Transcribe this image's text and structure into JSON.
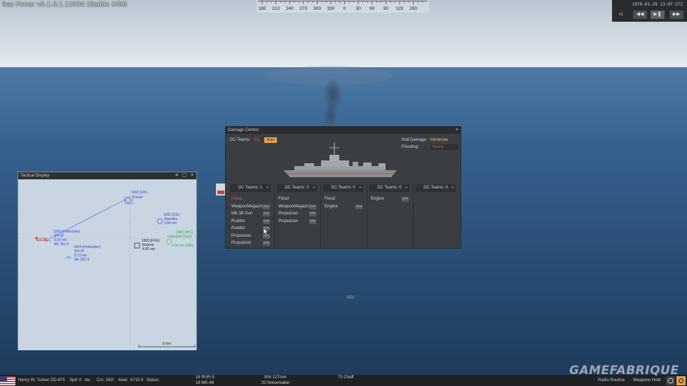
{
  "app": {
    "title": "Sea Power v0.1.0.1.12934 (Stable #60)"
  },
  "compass": {
    "ticks": [
      "180",
      "210",
      "240",
      "270",
      "300",
      "330",
      "0",
      "30",
      "60",
      "90",
      "120",
      "150"
    ]
  },
  "time_panel": {
    "datetime": "1979-01-29 13:07:37Z",
    "speed": "x1",
    "rewind_icon": "double-left-arrow",
    "play_pause_icon": "play-pause",
    "fast_forward_icon": "double-right-arrow"
  },
  "tactical": {
    "title": "Tactical Display",
    "scale": "5 km",
    "contacts": [
      {
        "id": "1002 (DD)",
        "name": "Tucker"
      },
      {
        "id": "1001 (CG)",
        "name": "Standley",
        "range": "3.84 nm"
      },
      {
        "id": "1005 (Helicopter)",
        "name": "SH-2F",
        "range": "9.02 nm",
        "alt": "Alt: 201 ft"
      },
      {
        "id": "1004 (Helicopter)",
        "name": "SH-2F",
        "range": "8.13 nm",
        "alt": "Alt: 201 ft"
      },
      {
        "id": "1003 (FFG)",
        "name": "Elsieon",
        "range": "4.82 nm"
      },
      {
        "id": "1002 (MG)",
        "name": "Unknown (Sub)",
        "range": "4.02 nm (ISR)"
      },
      {
        "time_marker": "13:38"
      }
    ]
  },
  "damage": {
    "title": "Damage Control",
    "dc_teams_label": "DC Teams:",
    "dc_teams_value": "0/1",
    "auto_label": "Auto",
    "hull_label": "Hull Damage:",
    "hull_value": "Moderate",
    "flooding_label": "Flooding:",
    "flooding_value": "Heavy",
    "go_label": ">>>",
    "columns": [
      {
        "head": "DC Teams: 1",
        "items": [
          {
            "label": "Flood",
            "flood": true,
            "go": false
          },
          {
            "label": "WeaponMagazine",
            "go": true
          },
          {
            "label": "MK 38 Gun",
            "go": true
          },
          {
            "label": "Rudder",
            "go": true
          },
          {
            "label": "Rudder",
            "go": true
          },
          {
            "label": "Propulsion",
            "go": true
          },
          {
            "label": "Propulsion",
            "go": true
          }
        ]
      },
      {
        "head": "DC Teams: 0",
        "items": [
          {
            "label": "Flood",
            "go": false
          },
          {
            "label": "WeaponMagazine",
            "go": true
          },
          {
            "label": "Propulsion",
            "go": true
          },
          {
            "label": "Propulsion",
            "go": true
          }
        ]
      },
      {
        "head": "DC Teams: 0",
        "items": [
          {
            "label": "Flood",
            "go": false
          },
          {
            "label": "Engine",
            "go": true
          }
        ]
      },
      {
        "head": "DC Teams: 0",
        "items": [
          {
            "label": "Engine",
            "go": true
          }
        ]
      },
      {
        "head": "DC Teams: 0",
        "items": []
      }
    ]
  },
  "status_bar": {
    "ship": "Henry W. Tucker DD-875",
    "spd_label": "Spd:",
    "spd_value": "0",
    "spd_unit": "kts",
    "crs_label": "Crs:",
    "crs_value": "263°",
    "keel_label": "Keel:",
    "keel_value": "6715 ft",
    "status_label": "Status:",
    "weapons": [
      {
        "count": "16",
        "name": "RUR-5"
      },
      {
        "count": "18",
        "name": "MK-46"
      },
      {
        "count": "904",
        "name": "127mm"
      },
      {
        "count": "20",
        "name": "Noisemaker"
      },
      {
        "count": "70",
        "name": "Chaff"
      }
    ],
    "radio": "Radio Routine",
    "weapons_hold": "Weapons Hold"
  },
  "watermark": "GAMEFABRIQUE",
  "colors": {
    "sky_top": "#c8d3dd",
    "sea": "#355e8d",
    "accent_orange": "#e4a44c",
    "alert_red": "#d65a4a",
    "friendly_blue": "#3b55d8",
    "unknown_green": "#52c45a"
  }
}
